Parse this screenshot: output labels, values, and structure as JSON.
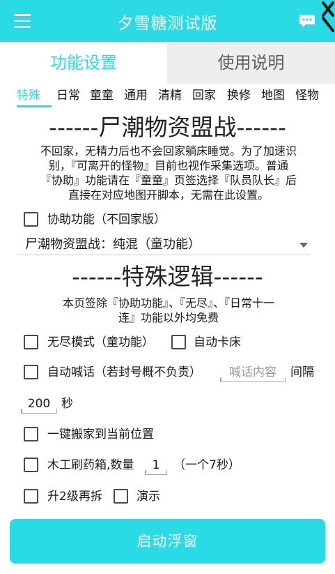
{
  "appbar": {
    "title": "夕雪糖测试版",
    "menu_icon": "hamburger-menu-icon",
    "chat_icon": "chat-bubble-icon",
    "corner_icon": "close-x-icon",
    "color": "#2adbe6"
  },
  "tabs": [
    {
      "label": "功能设置",
      "active": true
    },
    {
      "label": "使用说明",
      "active": false
    }
  ],
  "subtabs": [
    "特殊",
    "日常",
    "童童",
    "通用",
    "清精",
    "回家",
    "换修",
    "地图",
    "怪物"
  ],
  "section1": {
    "title": "------尸潮物资盟战------",
    "para_lines": [
      "不回家，无精力后也不会回家躺床睡觉。为了加速识",
      "别，『可离开的怪物』目前也视作采集选项。普通",
      "『协助』功能请在『童童』页签选择『队员队长』后",
      "直接在对应地图开脚本，无需在此设置。"
    ],
    "assist_label": "协助功能（不回家版）",
    "mode_select": "尸潮物资盟战：纯混（童功能）"
  },
  "section2": {
    "title": "------特殊逻辑------",
    "para_lines": [
      "本页签除『协助功能』、『无尽』、『日常十一",
      "连』功能以外均免费"
    ],
    "endless_label": "无尽模式（童功能）",
    "auto_stuck_label": "自动卡床",
    "auto_shout_label": "自动喊话（若封号概不负责）",
    "shout_placeholder": "喊话内容",
    "interval_label": "间隔",
    "interval_value": "200",
    "seconds_label": "秒",
    "move_home_label": "一键搬家到当前位置",
    "carpentry_label": "木工刷药箱,数量",
    "carpentry_qty": "1",
    "carpentry_note": "（一个7秒）",
    "upgrade_label": "升2级再拆",
    "demo_label": "演示"
  },
  "start_button": "启动浮窗"
}
